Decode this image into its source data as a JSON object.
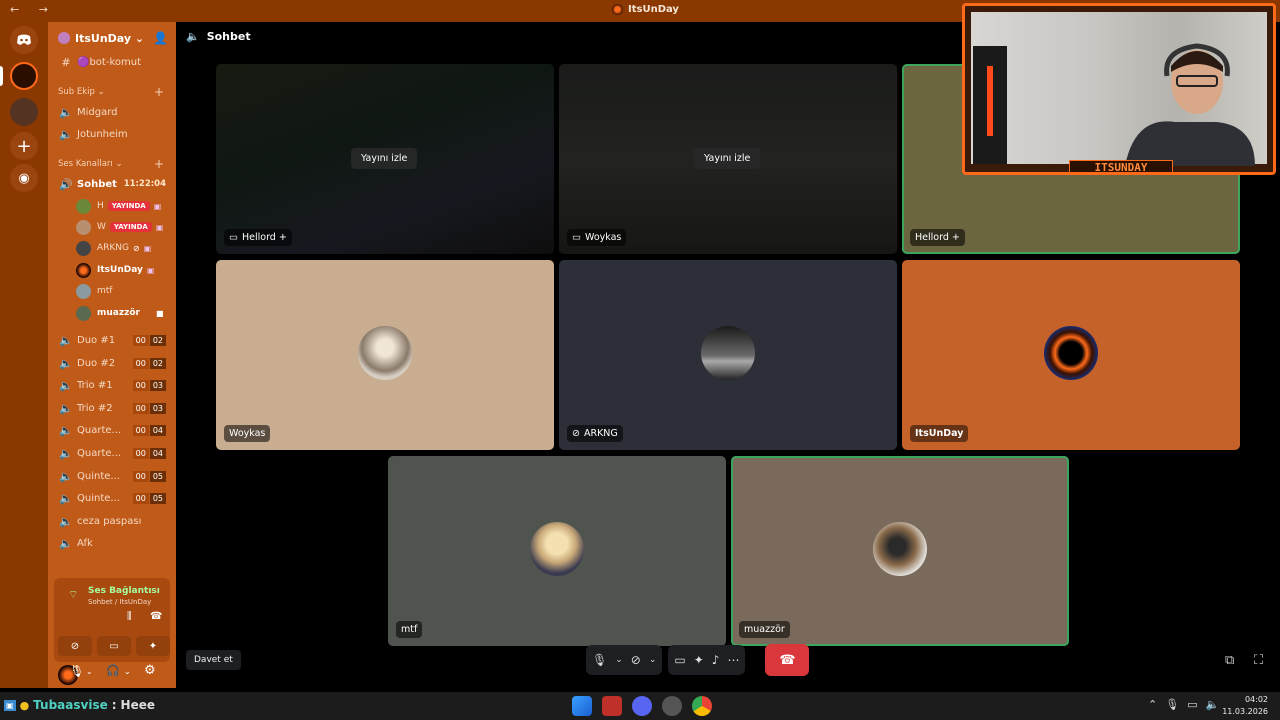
{
  "window": {
    "title": "ItsUnDay",
    "nav": "← →"
  },
  "server": {
    "name": "ItsUnDay ⌄"
  },
  "channels": {
    "text_channel": "🟣bot-komut",
    "category_sub": "Sub Ekip ⌄",
    "sub_channels": [
      "Midgard",
      "Jotunheim"
    ],
    "category_voice": "Ses Kanalları ⌄",
    "active_voice": {
      "name": "Sohbet",
      "time": "11:22:04"
    },
    "members": [
      {
        "name": "H",
        "live": "YAYINDA"
      },
      {
        "name": "W",
        "live": "YAYINDA"
      },
      {
        "name": "ARKNG",
        "live": ""
      },
      {
        "name": "ItsUnDay",
        "live": ""
      },
      {
        "name": "mtf",
        "live": ""
      },
      {
        "name": "muazzör",
        "live": ""
      }
    ],
    "voice_channels": [
      {
        "name": "Duo #1",
        "a": "00",
        "b": "02"
      },
      {
        "name": "Duo #2",
        "a": "00",
        "b": "02"
      },
      {
        "name": "Trio #1",
        "a": "00",
        "b": "03"
      },
      {
        "name": "Trio #2",
        "a": "00",
        "b": "03"
      },
      {
        "name": "Quarte...",
        "a": "00",
        "b": "04"
      },
      {
        "name": "Quarte...",
        "a": "00",
        "b": "04"
      },
      {
        "name": "Quinte...",
        "a": "00",
        "b": "05"
      },
      {
        "name": "Quinte...",
        "a": "00",
        "b": "05"
      },
      {
        "name": "ceza paspası",
        "a": "",
        "b": ""
      },
      {
        "name": "Afk",
        "a": "",
        "b": ""
      }
    ]
  },
  "voice_panel": {
    "title": "Ses Bağlantısı K",
    "subtitle": "Sohbet / ItsUnDay"
  },
  "call": {
    "channel_title": "Sohbet",
    "watch_label": "Yayını izle",
    "tiles": [
      {
        "name": "Hellord +",
        "type": "stream"
      },
      {
        "name": "Woykas",
        "type": "stream"
      },
      {
        "name": "Hellord +",
        "type": "user"
      },
      {
        "name": "Woykas",
        "type": "user"
      },
      {
        "name": "ARKNG",
        "type": "user"
      },
      {
        "name": "ItsUnDay",
        "type": "user"
      },
      {
        "name": "mtf",
        "type": "user"
      },
      {
        "name": "muazzör",
        "type": "user"
      }
    ],
    "invite_label": "Davet et"
  },
  "webcam": {
    "brand": "ITSUNDAY"
  },
  "taskbar": {
    "ticker_user": "Tubaasvise",
    "ticker_sep": ":",
    "ticker_msg": "Heee",
    "time": "04:02",
    "date": "11.03.2026"
  },
  "colors": {
    "accent": "#ff6a1a",
    "sidebar": "#c05a18",
    "titlebar": "#8a3800",
    "live": "#e5323a",
    "end_call": "#da373c"
  },
  "icons": [
    "discord-icon",
    "hash-icon",
    "speaker-icon",
    "mic-icon",
    "headphones-icon",
    "settings-icon",
    "end-call-icon",
    "popout-icon",
    "fullscreen-icon"
  ]
}
